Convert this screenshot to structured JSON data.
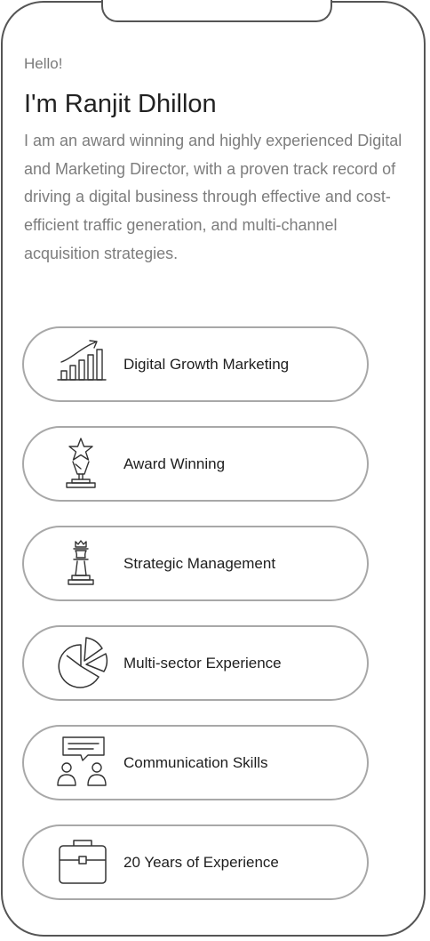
{
  "intro": {
    "greeting": "Hello!",
    "name": "I'm Ranjit Dhillon",
    "bio": "I am an award winning and highly experienced Digital and Marketing Director, with a proven track record of driving a digital business through effective and cost-efficient traffic generation, and multi-channel acquisition strategies."
  },
  "skills": [
    {
      "label": "Digital Growth Marketing",
      "icon": "growth-chart-icon"
    },
    {
      "label": "Award Winning",
      "icon": "trophy-star-icon"
    },
    {
      "label": "Strategic Management",
      "icon": "chess-king-icon"
    },
    {
      "label": "Multi-sector Experience",
      "icon": "pie-chart-icon"
    },
    {
      "label": "Communication Skills",
      "icon": "conversation-icon"
    },
    {
      "label": "20 Years of Experience",
      "icon": "briefcase-icon"
    }
  ],
  "colors": {
    "frame": "#555555",
    "pill_border": "#a8a8a8",
    "heading": "#222222",
    "body_text": "#7d7d7d"
  }
}
